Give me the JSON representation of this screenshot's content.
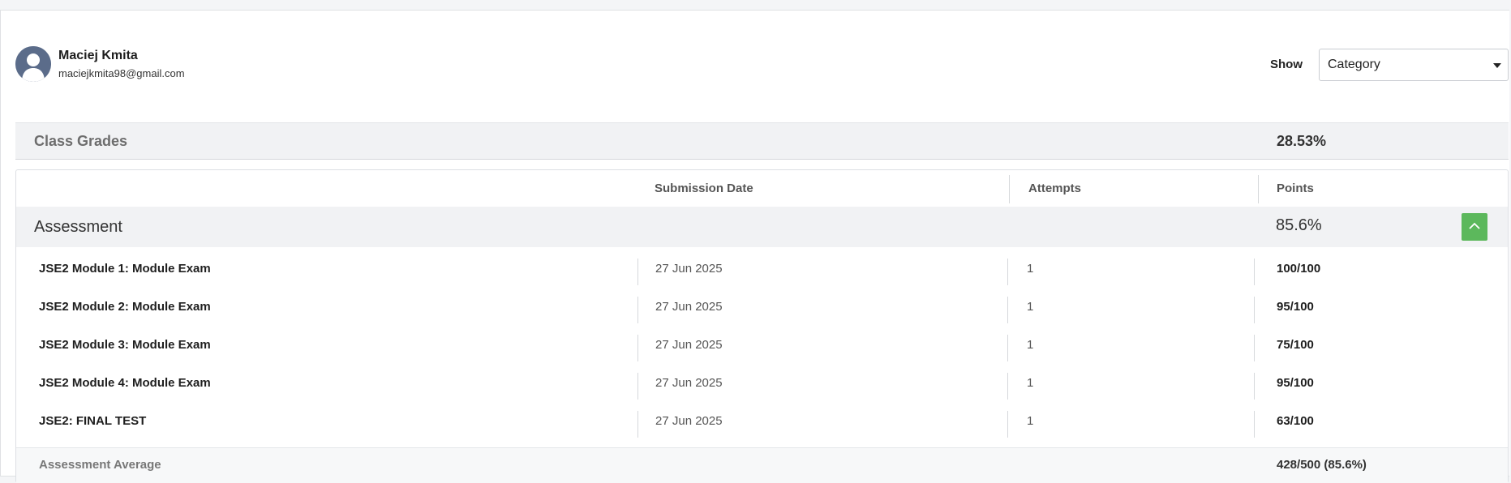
{
  "user": {
    "name": "Maciej Kmita",
    "email": "maciejkmita98@gmail.com"
  },
  "filter": {
    "show_label": "Show",
    "selected": "Category"
  },
  "class_grades": {
    "title": "Class Grades",
    "value": "28.53%"
  },
  "table": {
    "columns": {
      "submission_date": "Submission Date",
      "attempts": "Attempts",
      "points": "Points"
    },
    "category": {
      "name": "Assessment",
      "percent": "85.6%"
    },
    "rows": [
      {
        "title": "JSE2 Module 1: Module Exam",
        "date": "27 Jun 2025",
        "attempts": "1",
        "points": "100/100"
      },
      {
        "title": "JSE2 Module 2: Module Exam",
        "date": "27 Jun 2025",
        "attempts": "1",
        "points": "95/100"
      },
      {
        "title": "JSE2 Module 3: Module Exam",
        "date": "27 Jun 2025",
        "attempts": "1",
        "points": "75/100"
      },
      {
        "title": "JSE2 Module 4: Module Exam",
        "date": "27 Jun 2025",
        "attempts": "1",
        "points": "95/100"
      },
      {
        "title": "JSE2: FINAL TEST",
        "date": "27 Jun 2025",
        "attempts": "1",
        "points": "63/100"
      }
    ],
    "average": {
      "label": "Assessment Average",
      "value": "428/500 (85.6%)"
    }
  },
  "colors": {
    "accent_green": "#5cb85c",
    "avatar_bg": "#5b6c8a"
  },
  "icons": {
    "avatar": "user-silhouette-icon",
    "select_caret": "caret-down-icon",
    "collapse": "chevron-up-icon"
  }
}
